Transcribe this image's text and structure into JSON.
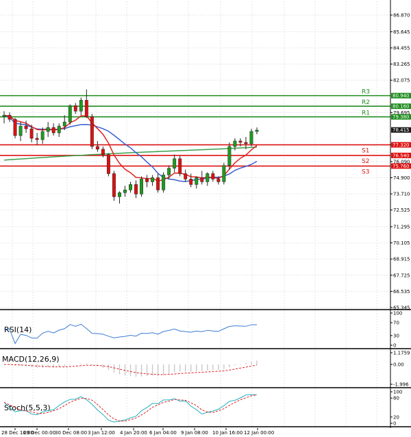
{
  "chart_data": [
    {
      "type": "candlestick",
      "panel": "price",
      "ylim": [
        65.345,
        86.87
      ],
      "y_ticks": [
        "86.870",
        "85.645",
        "84.455",
        "83.265",
        "82.075",
        "79.695",
        "77.320",
        "76.090",
        "74.900",
        "73.710",
        "72.525",
        "71.295",
        "70.105",
        "68.915",
        "67.725",
        "66.535",
        "65.345"
      ],
      "x_ticks": [
        "28 Dec 16:00",
        "29 Dec 00:00",
        "30 Dec 08:00",
        "3 Jan 12:00",
        "4 Jan 20:00",
        "6 Jan 04:00",
        "9 Jan 08:00",
        "10 Jan 16:00",
        "12 Jan 00:00"
      ],
      "current_price": "78.415",
      "levels": [
        {
          "name": "R3",
          "label": "R3",
          "value": 80.94,
          "value_text": "80.940",
          "color": "#1e8c1e"
        },
        {
          "name": "R2",
          "label": "R2",
          "value": 80.16,
          "value_text": "80.160",
          "color": "#1e8c1e"
        },
        {
          "name": "R1",
          "label": "R1",
          "value": 79.38,
          "value_text": "79.380",
          "color": "#1e8c1e"
        },
        {
          "name": "S1",
          "label": "S1",
          "value": 77.32,
          "value_text": "77.320",
          "color": "#dd1111"
        },
        {
          "name": "S2",
          "label": "S2",
          "value": 76.54,
          "value_text": "76.540",
          "color": "#dd1111"
        },
        {
          "name": "S3",
          "label": "S3",
          "value": 75.76,
          "value_text": "75.760",
          "color": "#dd1111"
        }
      ],
      "candles": [
        [
          79.4,
          79.8,
          78.9,
          79.5
        ],
        [
          79.5,
          79.7,
          79.0,
          79.2
        ],
        [
          79.2,
          79.3,
          77.8,
          78.0
        ],
        [
          78.0,
          79.0,
          77.6,
          78.7
        ],
        [
          78.7,
          79.1,
          78.2,
          78.5
        ],
        [
          78.5,
          78.8,
          77.5,
          77.8
        ],
        [
          77.8,
          78.2,
          77.3,
          77.7
        ],
        [
          77.7,
          78.6,
          77.4,
          78.3
        ],
        [
          78.3,
          79.0,
          77.9,
          78.6
        ],
        [
          78.6,
          78.9,
          78.0,
          78.2
        ],
        [
          78.2,
          78.9,
          77.9,
          78.7
        ],
        [
          78.7,
          79.5,
          78.4,
          79.0
        ],
        [
          79.0,
          80.3,
          78.8,
          80.2
        ],
        [
          80.2,
          80.4,
          79.6,
          79.8
        ],
        [
          79.8,
          80.8,
          79.5,
          80.6
        ],
        [
          80.6,
          81.4,
          79.3,
          79.4
        ],
        [
          79.4,
          79.6,
          77.0,
          77.2
        ],
        [
          77.2,
          77.6,
          76.8,
          77.0
        ],
        [
          77.0,
          77.2,
          76.4,
          76.6
        ],
        [
          76.6,
          76.7,
          75.0,
          75.2
        ],
        [
          75.2,
          75.4,
          73.2,
          73.5
        ],
        [
          73.5,
          73.9,
          73.0,
          73.8
        ],
        [
          73.8,
          74.3,
          73.5,
          74.0
        ],
        [
          74.0,
          74.6,
          73.8,
          74.4
        ],
        [
          74.4,
          74.7,
          73.4,
          73.7
        ],
        [
          73.7,
          75.0,
          73.5,
          74.8
        ],
        [
          74.8,
          75.1,
          74.2,
          74.6
        ],
        [
          74.6,
          75.1,
          74.3,
          74.9
        ],
        [
          74.9,
          75.2,
          73.8,
          74.0
        ],
        [
          74.0,
          75.3,
          73.8,
          75.1
        ],
        [
          75.1,
          75.8,
          74.8,
          75.6
        ],
        [
          75.6,
          76.6,
          75.3,
          76.3
        ],
        [
          76.3,
          76.5,
          75.0,
          75.2
        ],
        [
          75.2,
          75.5,
          74.6,
          74.8
        ],
        [
          74.8,
          75.2,
          74.2,
          74.4
        ],
        [
          74.4,
          75.0,
          74.1,
          74.9
        ],
        [
          74.9,
          75.4,
          74.4,
          74.6
        ],
        [
          74.6,
          75.3,
          74.3,
          75.2
        ],
        [
          75.2,
          75.4,
          74.6,
          74.8
        ],
        [
          74.8,
          75.0,
          74.4,
          74.6
        ],
        [
          74.6,
          76.0,
          74.4,
          75.8
        ],
        [
          75.8,
          77.5,
          75.5,
          77.2
        ],
        [
          77.2,
          77.8,
          76.9,
          77.6
        ],
        [
          77.6,
          77.8,
          77.2,
          77.5
        ],
        [
          77.5,
          77.9,
          77.0,
          77.4
        ],
        [
          77.4,
          78.5,
          77.2,
          78.3
        ],
        [
          78.3,
          78.6,
          78.1,
          78.4
        ]
      ]
    },
    {
      "type": "line",
      "panel": "rsi",
      "title": "RSI(14)",
      "y_ticks": [
        "100",
        "70",
        "30",
        "0"
      ],
      "ylim": [
        0,
        100
      ]
    },
    {
      "type": "bar",
      "panel": "macd",
      "title": "MACD(12,26,9)",
      "y_ticks": [
        "1.1759",
        "0.00",
        "-1.996"
      ],
      "ylim": [
        -1.996,
        1.1759
      ]
    },
    {
      "type": "line",
      "panel": "stoch",
      "title": "Stoch(5,5,3)",
      "y_ticks": [
        "100",
        "80",
        "20",
        "0"
      ],
      "ylim": [
        0,
        100
      ]
    }
  ],
  "colors": {
    "bull": "#1e9c1e",
    "bear": "#dd1111",
    "ma_fast": "#e02020",
    "ma_mid": "#3a5fd0",
    "ma_slow": "#3aa04a",
    "rsi": "#3a7bd5",
    "macd_signal": "#e02020",
    "stoch_k": "#20b0c0",
    "stoch_d": "#e02020",
    "grid": "#e6e6e6",
    "current_box": "#1a1a1a"
  }
}
